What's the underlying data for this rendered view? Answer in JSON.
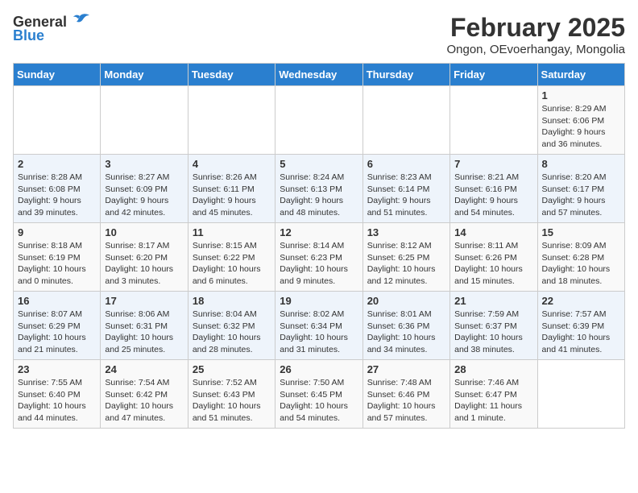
{
  "header": {
    "logo_general": "General",
    "logo_blue": "Blue",
    "month": "February 2025",
    "location": "Ongon, OEvoerhangay, Mongolia"
  },
  "days_of_week": [
    "Sunday",
    "Monday",
    "Tuesday",
    "Wednesday",
    "Thursday",
    "Friday",
    "Saturday"
  ],
  "weeks": [
    [
      {
        "day": "",
        "info": ""
      },
      {
        "day": "",
        "info": ""
      },
      {
        "day": "",
        "info": ""
      },
      {
        "day": "",
        "info": ""
      },
      {
        "day": "",
        "info": ""
      },
      {
        "day": "",
        "info": ""
      },
      {
        "day": "1",
        "info": "Sunrise: 8:29 AM\nSunset: 6:06 PM\nDaylight: 9 hours and 36 minutes."
      }
    ],
    [
      {
        "day": "2",
        "info": "Sunrise: 8:28 AM\nSunset: 6:08 PM\nDaylight: 9 hours and 39 minutes."
      },
      {
        "day": "3",
        "info": "Sunrise: 8:27 AM\nSunset: 6:09 PM\nDaylight: 9 hours and 42 minutes."
      },
      {
        "day": "4",
        "info": "Sunrise: 8:26 AM\nSunset: 6:11 PM\nDaylight: 9 hours and 45 minutes."
      },
      {
        "day": "5",
        "info": "Sunrise: 8:24 AM\nSunset: 6:13 PM\nDaylight: 9 hours and 48 minutes."
      },
      {
        "day": "6",
        "info": "Sunrise: 8:23 AM\nSunset: 6:14 PM\nDaylight: 9 hours and 51 minutes."
      },
      {
        "day": "7",
        "info": "Sunrise: 8:21 AM\nSunset: 6:16 PM\nDaylight: 9 hours and 54 minutes."
      },
      {
        "day": "8",
        "info": "Sunrise: 8:20 AM\nSunset: 6:17 PM\nDaylight: 9 hours and 57 minutes."
      }
    ],
    [
      {
        "day": "9",
        "info": "Sunrise: 8:18 AM\nSunset: 6:19 PM\nDaylight: 10 hours and 0 minutes."
      },
      {
        "day": "10",
        "info": "Sunrise: 8:17 AM\nSunset: 6:20 PM\nDaylight: 10 hours and 3 minutes."
      },
      {
        "day": "11",
        "info": "Sunrise: 8:15 AM\nSunset: 6:22 PM\nDaylight: 10 hours and 6 minutes."
      },
      {
        "day": "12",
        "info": "Sunrise: 8:14 AM\nSunset: 6:23 PM\nDaylight: 10 hours and 9 minutes."
      },
      {
        "day": "13",
        "info": "Sunrise: 8:12 AM\nSunset: 6:25 PM\nDaylight: 10 hours and 12 minutes."
      },
      {
        "day": "14",
        "info": "Sunrise: 8:11 AM\nSunset: 6:26 PM\nDaylight: 10 hours and 15 minutes."
      },
      {
        "day": "15",
        "info": "Sunrise: 8:09 AM\nSunset: 6:28 PM\nDaylight: 10 hours and 18 minutes."
      }
    ],
    [
      {
        "day": "16",
        "info": "Sunrise: 8:07 AM\nSunset: 6:29 PM\nDaylight: 10 hours and 21 minutes."
      },
      {
        "day": "17",
        "info": "Sunrise: 8:06 AM\nSunset: 6:31 PM\nDaylight: 10 hours and 25 minutes."
      },
      {
        "day": "18",
        "info": "Sunrise: 8:04 AM\nSunset: 6:32 PM\nDaylight: 10 hours and 28 minutes."
      },
      {
        "day": "19",
        "info": "Sunrise: 8:02 AM\nSunset: 6:34 PM\nDaylight: 10 hours and 31 minutes."
      },
      {
        "day": "20",
        "info": "Sunrise: 8:01 AM\nSunset: 6:36 PM\nDaylight: 10 hours and 34 minutes."
      },
      {
        "day": "21",
        "info": "Sunrise: 7:59 AM\nSunset: 6:37 PM\nDaylight: 10 hours and 38 minutes."
      },
      {
        "day": "22",
        "info": "Sunrise: 7:57 AM\nSunset: 6:39 PM\nDaylight: 10 hours and 41 minutes."
      }
    ],
    [
      {
        "day": "23",
        "info": "Sunrise: 7:55 AM\nSunset: 6:40 PM\nDaylight: 10 hours and 44 minutes."
      },
      {
        "day": "24",
        "info": "Sunrise: 7:54 AM\nSunset: 6:42 PM\nDaylight: 10 hours and 47 minutes."
      },
      {
        "day": "25",
        "info": "Sunrise: 7:52 AM\nSunset: 6:43 PM\nDaylight: 10 hours and 51 minutes."
      },
      {
        "day": "26",
        "info": "Sunrise: 7:50 AM\nSunset: 6:45 PM\nDaylight: 10 hours and 54 minutes."
      },
      {
        "day": "27",
        "info": "Sunrise: 7:48 AM\nSunset: 6:46 PM\nDaylight: 10 hours and 57 minutes."
      },
      {
        "day": "28",
        "info": "Sunrise: 7:46 AM\nSunset: 6:47 PM\nDaylight: 11 hours and 1 minute."
      },
      {
        "day": "",
        "info": ""
      }
    ]
  ]
}
